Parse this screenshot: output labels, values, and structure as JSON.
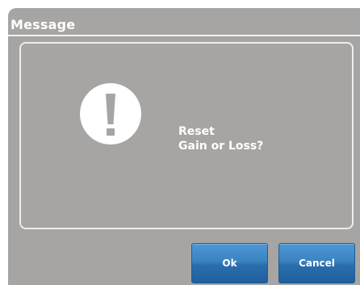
{
  "dialog": {
    "title": "Message",
    "icon": "exclamation-icon",
    "message_line1": "Reset",
    "message_line2": "Gain or Loss?"
  },
  "buttons": {
    "ok_label": "Ok",
    "cancel_label": "Cancel"
  },
  "colors": {
    "dialog_bg": "#a6a5a3",
    "button_blue": "#3a83c2",
    "text": "#ffffff"
  }
}
